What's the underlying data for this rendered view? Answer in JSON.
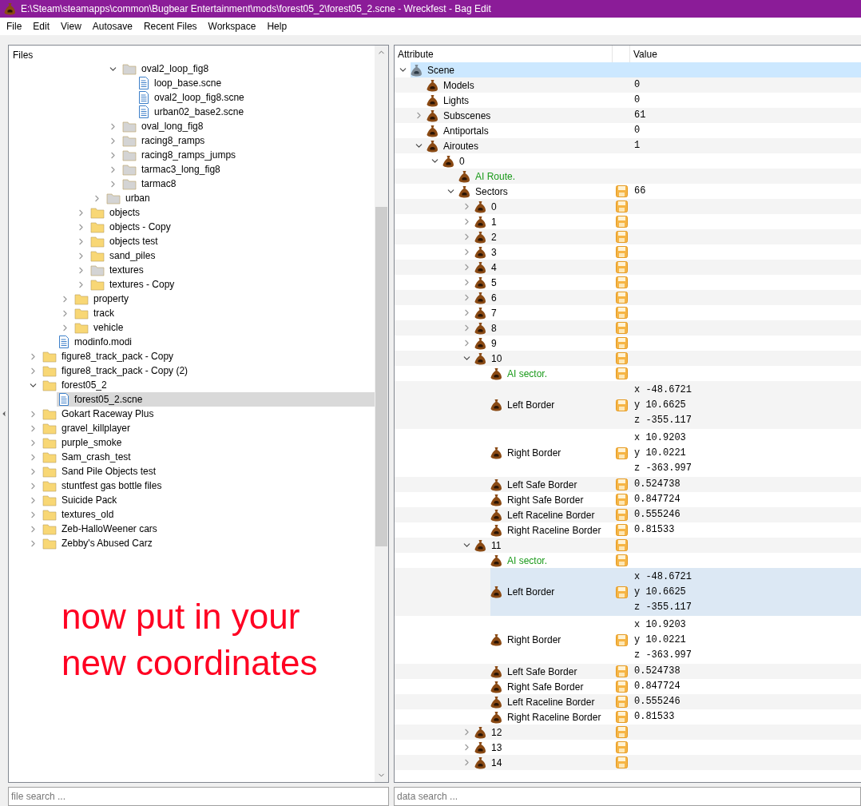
{
  "window": {
    "title": "E:\\Steam\\steamapps\\common\\Bugbear Entertainment\\mods\\forest05_2\\forest05_2.scne - Wreckfest - Bag Edit"
  },
  "menu": [
    "File",
    "Edit",
    "View",
    "Autosave",
    "Recent Files",
    "Workspace",
    "Help"
  ],
  "files": {
    "title": "Files",
    "tree": [
      {
        "children": [
          {
            "children": [
              {
                "children": [
                  {
                    "children": [
                      {
                        "children": [
                          {
                            "label": "oval2_loop_fig8",
                            "kind": "folder",
                            "color": "#d4d4d4",
                            "expanded": true,
                            "selected": false,
                            "children": [
                              {
                                "label": "loop_base.scne",
                                "kind": "file",
                                "selected": false
                              },
                              {
                                "label": "oval2_loop_fig8.scne",
                                "kind": "file",
                                "selected": false
                              },
                              {
                                "label": "urban02_base2.scne",
                                "kind": "file",
                                "selected": false
                              }
                            ]
                          },
                          {
                            "label": "oval_long_fig8",
                            "kind": "folder",
                            "color": "#d4d4d4",
                            "expanded": false,
                            "selected": false
                          },
                          {
                            "label": "racing8_ramps",
                            "kind": "folder",
                            "color": "#d4d4d4",
                            "expanded": false,
                            "selected": false
                          },
                          {
                            "label": "racing8_ramps_jumps",
                            "kind": "folder",
                            "color": "#d4d4d4",
                            "expanded": false,
                            "selected": false
                          },
                          {
                            "label": "tarmac3_long_fig8",
                            "kind": "folder",
                            "color": "#d4d4d4",
                            "expanded": false,
                            "selected": false
                          },
                          {
                            "label": "tarmac8",
                            "kind": "folder",
                            "color": "#d4d4d4",
                            "expanded": false,
                            "selected": false
                          }
                        ]
                      },
                      {
                        "label": "urban",
                        "kind": "folder",
                        "color": "#d4d4d4",
                        "expanded": false,
                        "selected": false
                      }
                    ]
                  },
                  {
                    "label": "objects",
                    "kind": "folder",
                    "color": "#f8d775",
                    "expanded": false,
                    "selected": false
                  },
                  {
                    "label": "objects - Copy",
                    "kind": "folder",
                    "color": "#f8d775",
                    "expanded": false,
                    "selected": false
                  },
                  {
                    "label": "objects test",
                    "kind": "folder",
                    "color": "#f8d775",
                    "expanded": false,
                    "selected": false
                  },
                  {
                    "label": "sand_piles",
                    "kind": "folder",
                    "color": "#f8d775",
                    "expanded": false,
                    "selected": false
                  },
                  {
                    "label": "textures",
                    "kind": "folder",
                    "color": "#d4d4d4",
                    "expanded": false,
                    "selected": false
                  },
                  {
                    "label": "textures - Copy",
                    "kind": "folder",
                    "color": "#f8d775",
                    "expanded": false,
                    "selected": false
                  }
                ]
              },
              {
                "label": "property",
                "kind": "folder",
                "color": "#f8d775",
                "expanded": false,
                "selected": false
              },
              {
                "label": "track",
                "kind": "folder",
                "color": "#f8d775",
                "expanded": false,
                "selected": false
              },
              {
                "label": "vehicle",
                "kind": "folder",
                "color": "#f8d775",
                "expanded": false,
                "selected": false
              }
            ]
          },
          {
            "label": "modinfo.modi",
            "kind": "file",
            "selected": false
          }
        ]
      },
      {
        "label": "figure8_track_pack - Copy",
        "kind": "folder",
        "color": "#f8d775",
        "expanded": false,
        "selected": false
      },
      {
        "label": "figure8_track_pack - Copy (2)",
        "kind": "folder",
        "color": "#f8d775",
        "expanded": false,
        "selected": false
      },
      {
        "label": "forest05_2",
        "kind": "folder",
        "color": "#f8d775",
        "expanded": true,
        "selected": false,
        "children": [
          {
            "label": "forest05_2.scne",
            "kind": "file",
            "selected": true
          }
        ]
      },
      {
        "label": "Gokart Raceway Plus",
        "kind": "folder",
        "color": "#f8d775",
        "expanded": false,
        "selected": false
      },
      {
        "label": "gravel_killplayer",
        "kind": "folder",
        "color": "#f8d775",
        "expanded": false,
        "selected": false
      },
      {
        "label": "purple_smoke",
        "kind": "folder",
        "color": "#f8d775",
        "expanded": false,
        "selected": false
      },
      {
        "label": "Sam_crash_test",
        "kind": "folder",
        "color": "#f8d775",
        "expanded": false,
        "selected": false
      },
      {
        "label": "Sand Pile Objects test",
        "kind": "folder",
        "color": "#f8d775",
        "expanded": false,
        "selected": false
      },
      {
        "label": "stuntfest gas bottle files",
        "kind": "folder",
        "color": "#f8d775",
        "expanded": false,
        "selected": false
      },
      {
        "label": "Suicide Pack",
        "kind": "folder",
        "color": "#f8d775",
        "expanded": false,
        "selected": false
      },
      {
        "label": "textures_old",
        "kind": "folder",
        "color": "#f8d775",
        "expanded": false,
        "selected": false
      },
      {
        "label": "Zeb-HalloWeener cars",
        "kind": "folder",
        "color": "#f8d775",
        "expanded": false,
        "selected": false
      },
      {
        "label": "Zebby's Abused Carz",
        "kind": "folder",
        "color": "#f8d775",
        "expanded": false,
        "selected": false
      }
    ]
  },
  "annotation": "now put in your new coordinates",
  "file_search": {
    "placeholder": "file search ..."
  },
  "attribute_tree": {
    "columns": [
      "Attribute",
      "Value"
    ],
    "rows": [
      {
        "label": "Scene",
        "kind": "root",
        "expanded": true,
        "selected": true,
        "savable": false,
        "children": [
          {
            "label": "Models",
            "kind": "node",
            "selected": false,
            "savable": false,
            "value": [
              "0"
            ]
          },
          {
            "label": "Lights",
            "kind": "node",
            "selected": false,
            "savable": false,
            "value": [
              "0"
            ]
          },
          {
            "label": "Subscenes",
            "kind": "node",
            "expanded": false,
            "selected": false,
            "savable": false,
            "value": [
              "61"
            ]
          },
          {
            "label": "Antiportals",
            "kind": "node",
            "selected": false,
            "savable": false,
            "value": [
              "0"
            ]
          },
          {
            "label": "Airoutes",
            "kind": "node",
            "expanded": true,
            "selected": false,
            "savable": false,
            "value": [
              "1"
            ],
            "children": [
              {
                "label": "0",
                "kind": "node",
                "expanded": true,
                "selected": false,
                "savable": false,
                "children": [
                  {
                    "label": "AI Route.",
                    "kind": "note",
                    "selected": false,
                    "savable": false
                  },
                  {
                    "label": "Sectors",
                    "kind": "node",
                    "expanded": true,
                    "selected": false,
                    "savable": true,
                    "value": [
                      "66"
                    ],
                    "children": [
                      {
                        "label": "0",
                        "kind": "node",
                        "expanded": false,
                        "selected": false,
                        "savable": true
                      },
                      {
                        "label": "1",
                        "kind": "node",
                        "expanded": false,
                        "selected": false,
                        "savable": true
                      },
                      {
                        "label": "2",
                        "kind": "node",
                        "expanded": false,
                        "selected": false,
                        "savable": true
                      },
                      {
                        "label": "3",
                        "kind": "node",
                        "expanded": false,
                        "selected": false,
                        "savable": true
                      },
                      {
                        "label": "4",
                        "kind": "node",
                        "expanded": false,
                        "selected": false,
                        "savable": true
                      },
                      {
                        "label": "5",
                        "kind": "node",
                        "expanded": false,
                        "selected": false,
                        "savable": true
                      },
                      {
                        "label": "6",
                        "kind": "node",
                        "expanded": false,
                        "selected": false,
                        "savable": true
                      },
                      {
                        "label": "7",
                        "kind": "node",
                        "expanded": false,
                        "selected": false,
                        "savable": true
                      },
                      {
                        "label": "8",
                        "kind": "node",
                        "expanded": false,
                        "selected": false,
                        "savable": true
                      },
                      {
                        "label": "9",
                        "kind": "node",
                        "expanded": false,
                        "selected": false,
                        "savable": true
                      },
                      {
                        "label": "10",
                        "kind": "node",
                        "expanded": true,
                        "selected": false,
                        "savable": true,
                        "children": [
                          {
                            "label": "AI sector.",
                            "kind": "note",
                            "selected": false,
                            "savable": true
                          },
                          {
                            "label": "Left Border",
                            "kind": "node",
                            "selected": false,
                            "savable": true,
                            "value": [
                              "x -48.6721",
                              "y 10.6625",
                              "z -355.117"
                            ]
                          },
                          {
                            "label": "Right Border",
                            "kind": "node",
                            "selected": false,
                            "savable": true,
                            "value": [
                              "x 10.9203",
                              "y 10.0221",
                              "z -363.997"
                            ]
                          },
                          {
                            "label": "Left Safe Border",
                            "kind": "node",
                            "selected": false,
                            "savable": true,
                            "value": [
                              "0.524738"
                            ]
                          },
                          {
                            "label": "Right Safe Border",
                            "kind": "node",
                            "selected": false,
                            "savable": true,
                            "value": [
                              "0.847724"
                            ]
                          },
                          {
                            "label": "Left Raceline Border",
                            "kind": "node",
                            "selected": false,
                            "savable": true,
                            "value": [
                              "0.555246"
                            ]
                          },
                          {
                            "label": "Right Raceline Border",
                            "kind": "node",
                            "selected": false,
                            "savable": true,
                            "value": [
                              "0.81533"
                            ]
                          }
                        ]
                      },
                      {
                        "label": "11",
                        "kind": "node",
                        "expanded": true,
                        "selected": false,
                        "savable": true,
                        "children": [
                          {
                            "label": "AI sector.",
                            "kind": "note",
                            "selected": false,
                            "savable": true
                          },
                          {
                            "label": "Left Border",
                            "kind": "node",
                            "selected": true,
                            "savable": true,
                            "value": [
                              "x -48.6721",
                              "y 10.6625",
                              "z -355.117"
                            ]
                          },
                          {
                            "label": "Right Border",
                            "kind": "node",
                            "selected": false,
                            "savable": true,
                            "value": [
                              "x 10.9203",
                              "y 10.0221",
                              "z -363.997"
                            ]
                          },
                          {
                            "label": "Left Safe Border",
                            "kind": "node",
                            "selected": false,
                            "savable": true,
                            "value": [
                              "0.524738"
                            ]
                          },
                          {
                            "label": "Right Safe Border",
                            "kind": "node",
                            "selected": false,
                            "savable": true,
                            "value": [
                              "0.847724"
                            ]
                          },
                          {
                            "label": "Left Raceline Border",
                            "kind": "node",
                            "selected": false,
                            "savable": true,
                            "value": [
                              "0.555246"
                            ]
                          },
                          {
                            "label": "Right Raceline Border",
                            "kind": "node",
                            "selected": false,
                            "savable": true,
                            "value": [
                              "0.81533"
                            ]
                          }
                        ]
                      },
                      {
                        "label": "12",
                        "kind": "node",
                        "expanded": false,
                        "selected": false,
                        "savable": true
                      },
                      {
                        "label": "13",
                        "kind": "node",
                        "expanded": false,
                        "selected": false,
                        "savable": true
                      },
                      {
                        "label": "14",
                        "kind": "node",
                        "expanded": false,
                        "selected": false,
                        "savable": true
                      }
                    ]
                  }
                ]
              }
            ]
          }
        ]
      }
    ]
  },
  "data_search": {
    "placeholder": "data search ..."
  }
}
